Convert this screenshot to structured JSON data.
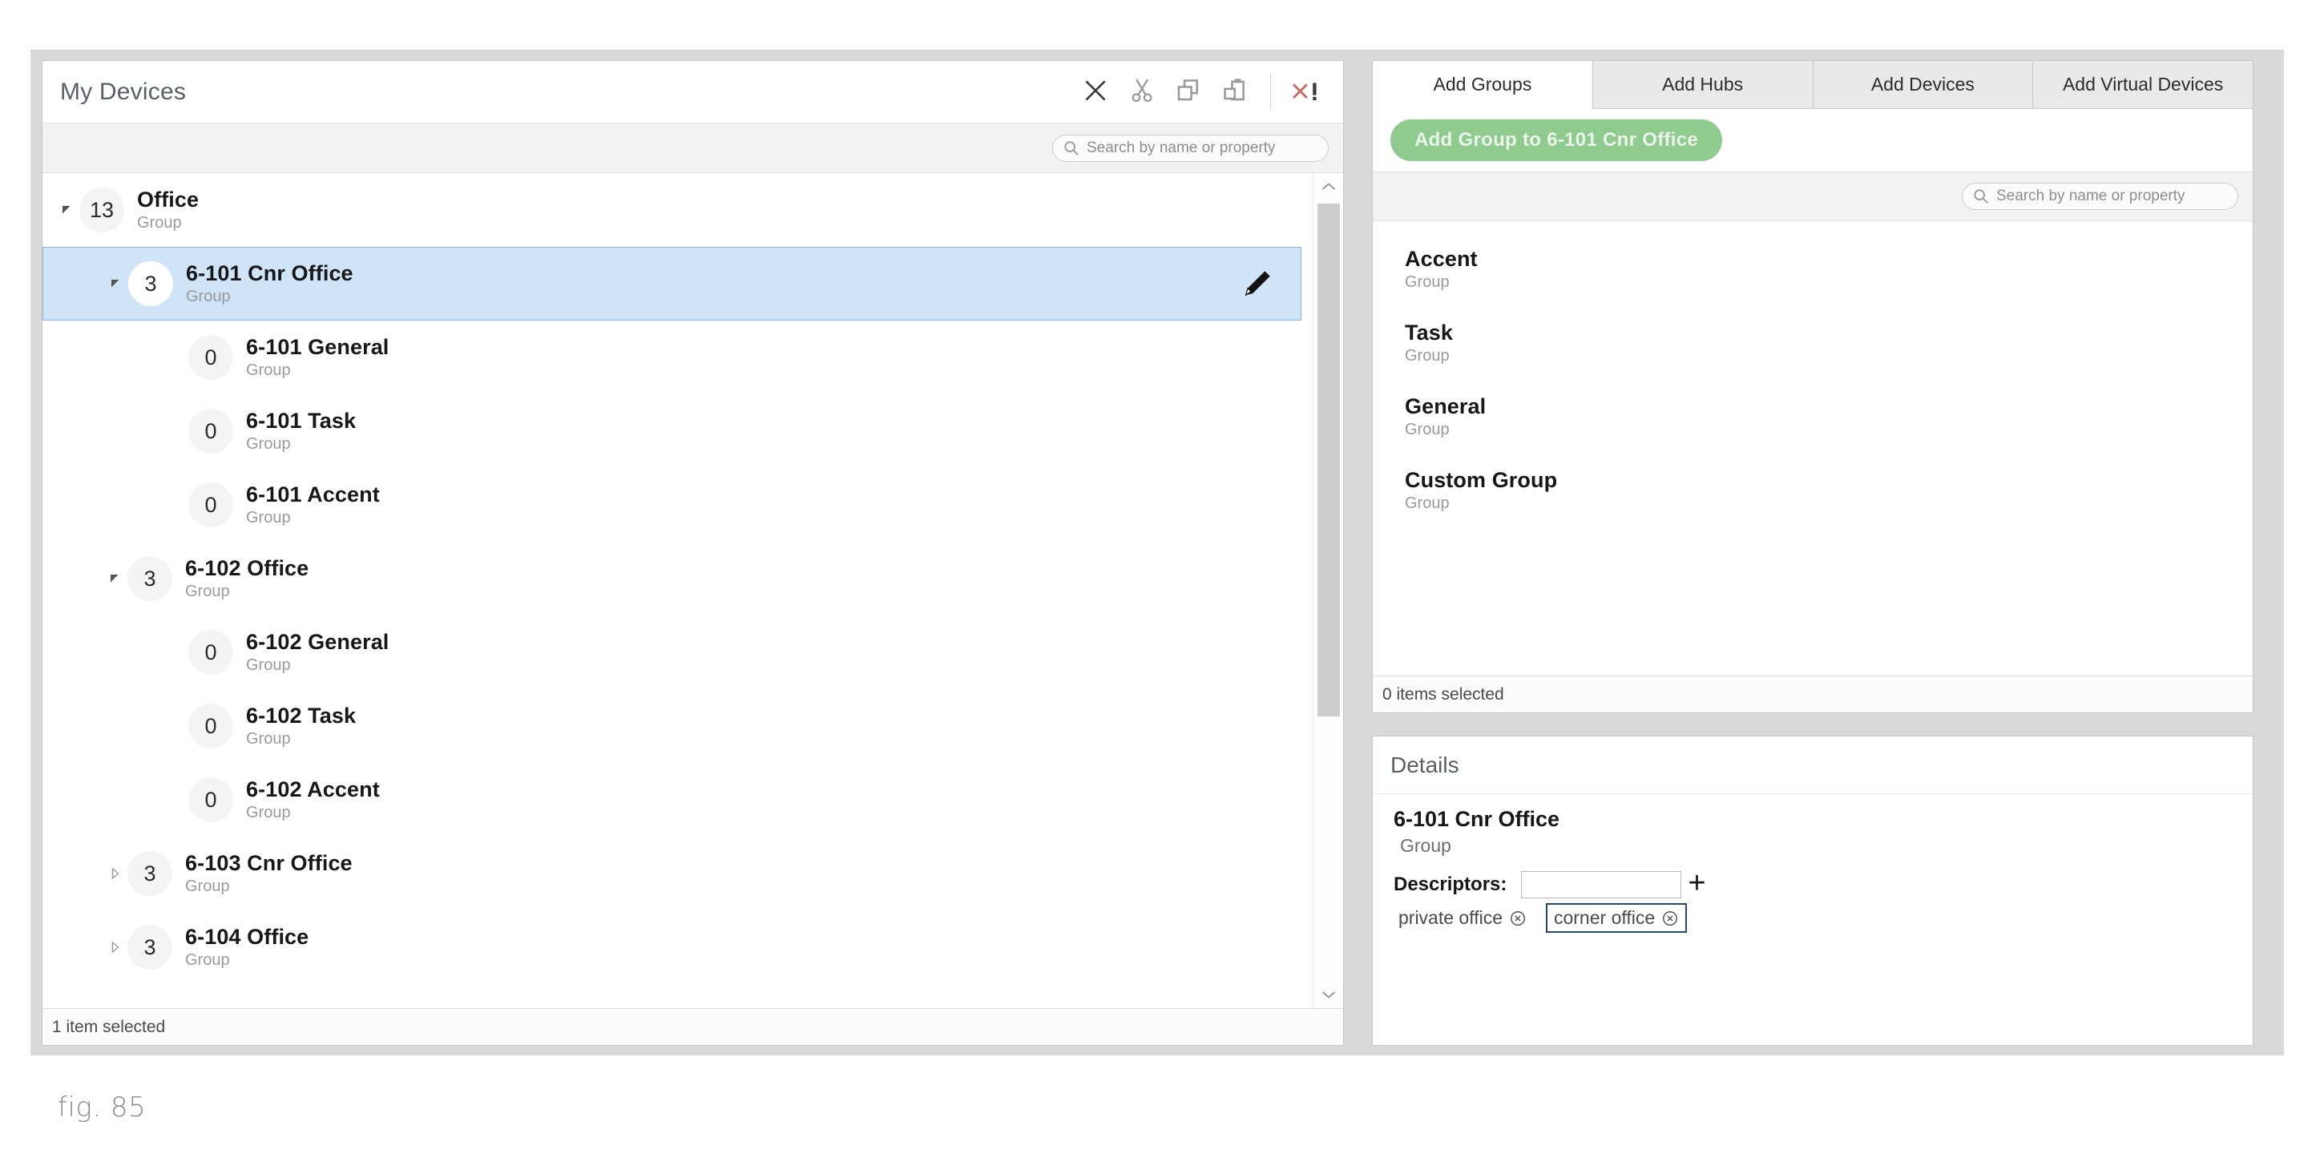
{
  "left_panel": {
    "title": "My Devices",
    "toolbar": [
      {
        "name": "delete-icon",
        "glyph": "x-bold",
        "label": "Delete"
      },
      {
        "name": "cut-icon",
        "glyph": "scissors",
        "label": "Cut"
      },
      {
        "name": "copy-icon",
        "glyph": "copy",
        "label": "Copy"
      },
      {
        "name": "paste-icon",
        "glyph": "paste",
        "label": "Paste"
      },
      {
        "name": "clear-errors-icon",
        "glyph": "x-exclaim",
        "label": "x!"
      }
    ],
    "search": {
      "placeholder": "Search by name or property",
      "value": "",
      "icon": "search-icon"
    },
    "tree": [
      {
        "count": "13",
        "name": "Office",
        "type": "Group",
        "depth": 0,
        "state": "expanded",
        "selected": false,
        "edit": false
      },
      {
        "count": "3",
        "name": "6-101 Cnr Office",
        "type": "Group",
        "depth": 1,
        "state": "expanded",
        "selected": true,
        "edit": true
      },
      {
        "count": "0",
        "name": "6-101 General",
        "type": "Group",
        "depth": 2,
        "state": "leaf",
        "selected": false,
        "edit": false
      },
      {
        "count": "0",
        "name": "6-101 Task",
        "type": "Group",
        "depth": 2,
        "state": "leaf",
        "selected": false,
        "edit": false
      },
      {
        "count": "0",
        "name": "6-101 Accent",
        "type": "Group",
        "depth": 2,
        "state": "leaf",
        "selected": false,
        "edit": false
      },
      {
        "count": "3",
        "name": "6-102 Office",
        "type": "Group",
        "depth": 1,
        "state": "expanded",
        "selected": false,
        "edit": false
      },
      {
        "count": "0",
        "name": "6-102 General",
        "type": "Group",
        "depth": 2,
        "state": "leaf",
        "selected": false,
        "edit": false
      },
      {
        "count": "0",
        "name": "6-102 Task",
        "type": "Group",
        "depth": 2,
        "state": "leaf",
        "selected": false,
        "edit": false
      },
      {
        "count": "0",
        "name": "6-102 Accent",
        "type": "Group",
        "depth": 2,
        "state": "leaf",
        "selected": false,
        "edit": false
      },
      {
        "count": "3",
        "name": "6-103 Cnr Office",
        "type": "Group",
        "depth": 1,
        "state": "collapsed",
        "selected": false,
        "edit": false
      },
      {
        "count": "3",
        "name": "6-104 Office",
        "type": "Group",
        "depth": 1,
        "state": "collapsed",
        "selected": false,
        "edit": false
      }
    ],
    "status": "1 item selected"
  },
  "right_panel": {
    "tabs": [
      {
        "label": "Add Groups",
        "active": true
      },
      {
        "label": "Add Hubs",
        "active": false
      },
      {
        "label": "Add Devices",
        "active": false
      },
      {
        "label": "Add Virtual Devices",
        "active": false
      }
    ],
    "add_button": {
      "label": "Add Group to 6-101 Cnr Office",
      "color": "#8fcb8f"
    },
    "search": {
      "placeholder": "Search by name or property",
      "value": "",
      "icon": "search-icon"
    },
    "items": [
      {
        "name": "Accent",
        "type": "Group"
      },
      {
        "name": "Task",
        "type": "Group"
      },
      {
        "name": "General",
        "type": "Group"
      },
      {
        "name": "Custom Group",
        "type": "Group"
      }
    ],
    "status": "0 items selected"
  },
  "details_panel": {
    "title": "Details",
    "object_name": "6-101 Cnr Office",
    "object_type": "Group",
    "descriptors_label": "Descriptors:",
    "descriptor_input": {
      "value": "",
      "placeholder": ""
    },
    "add_descriptor_glyph": "+",
    "tags": [
      {
        "label": "private office",
        "focused": false
      },
      {
        "label": "corner office",
        "focused": true
      }
    ]
  },
  "caption": "fig. 85",
  "colors": {
    "selection_bg": "#cfe4f7",
    "selection_border": "#8ab4e0",
    "accent_green": "#8fcb8f",
    "tag_focus_border": "#24486e",
    "chrome_grey": "#d9d9d9"
  }
}
